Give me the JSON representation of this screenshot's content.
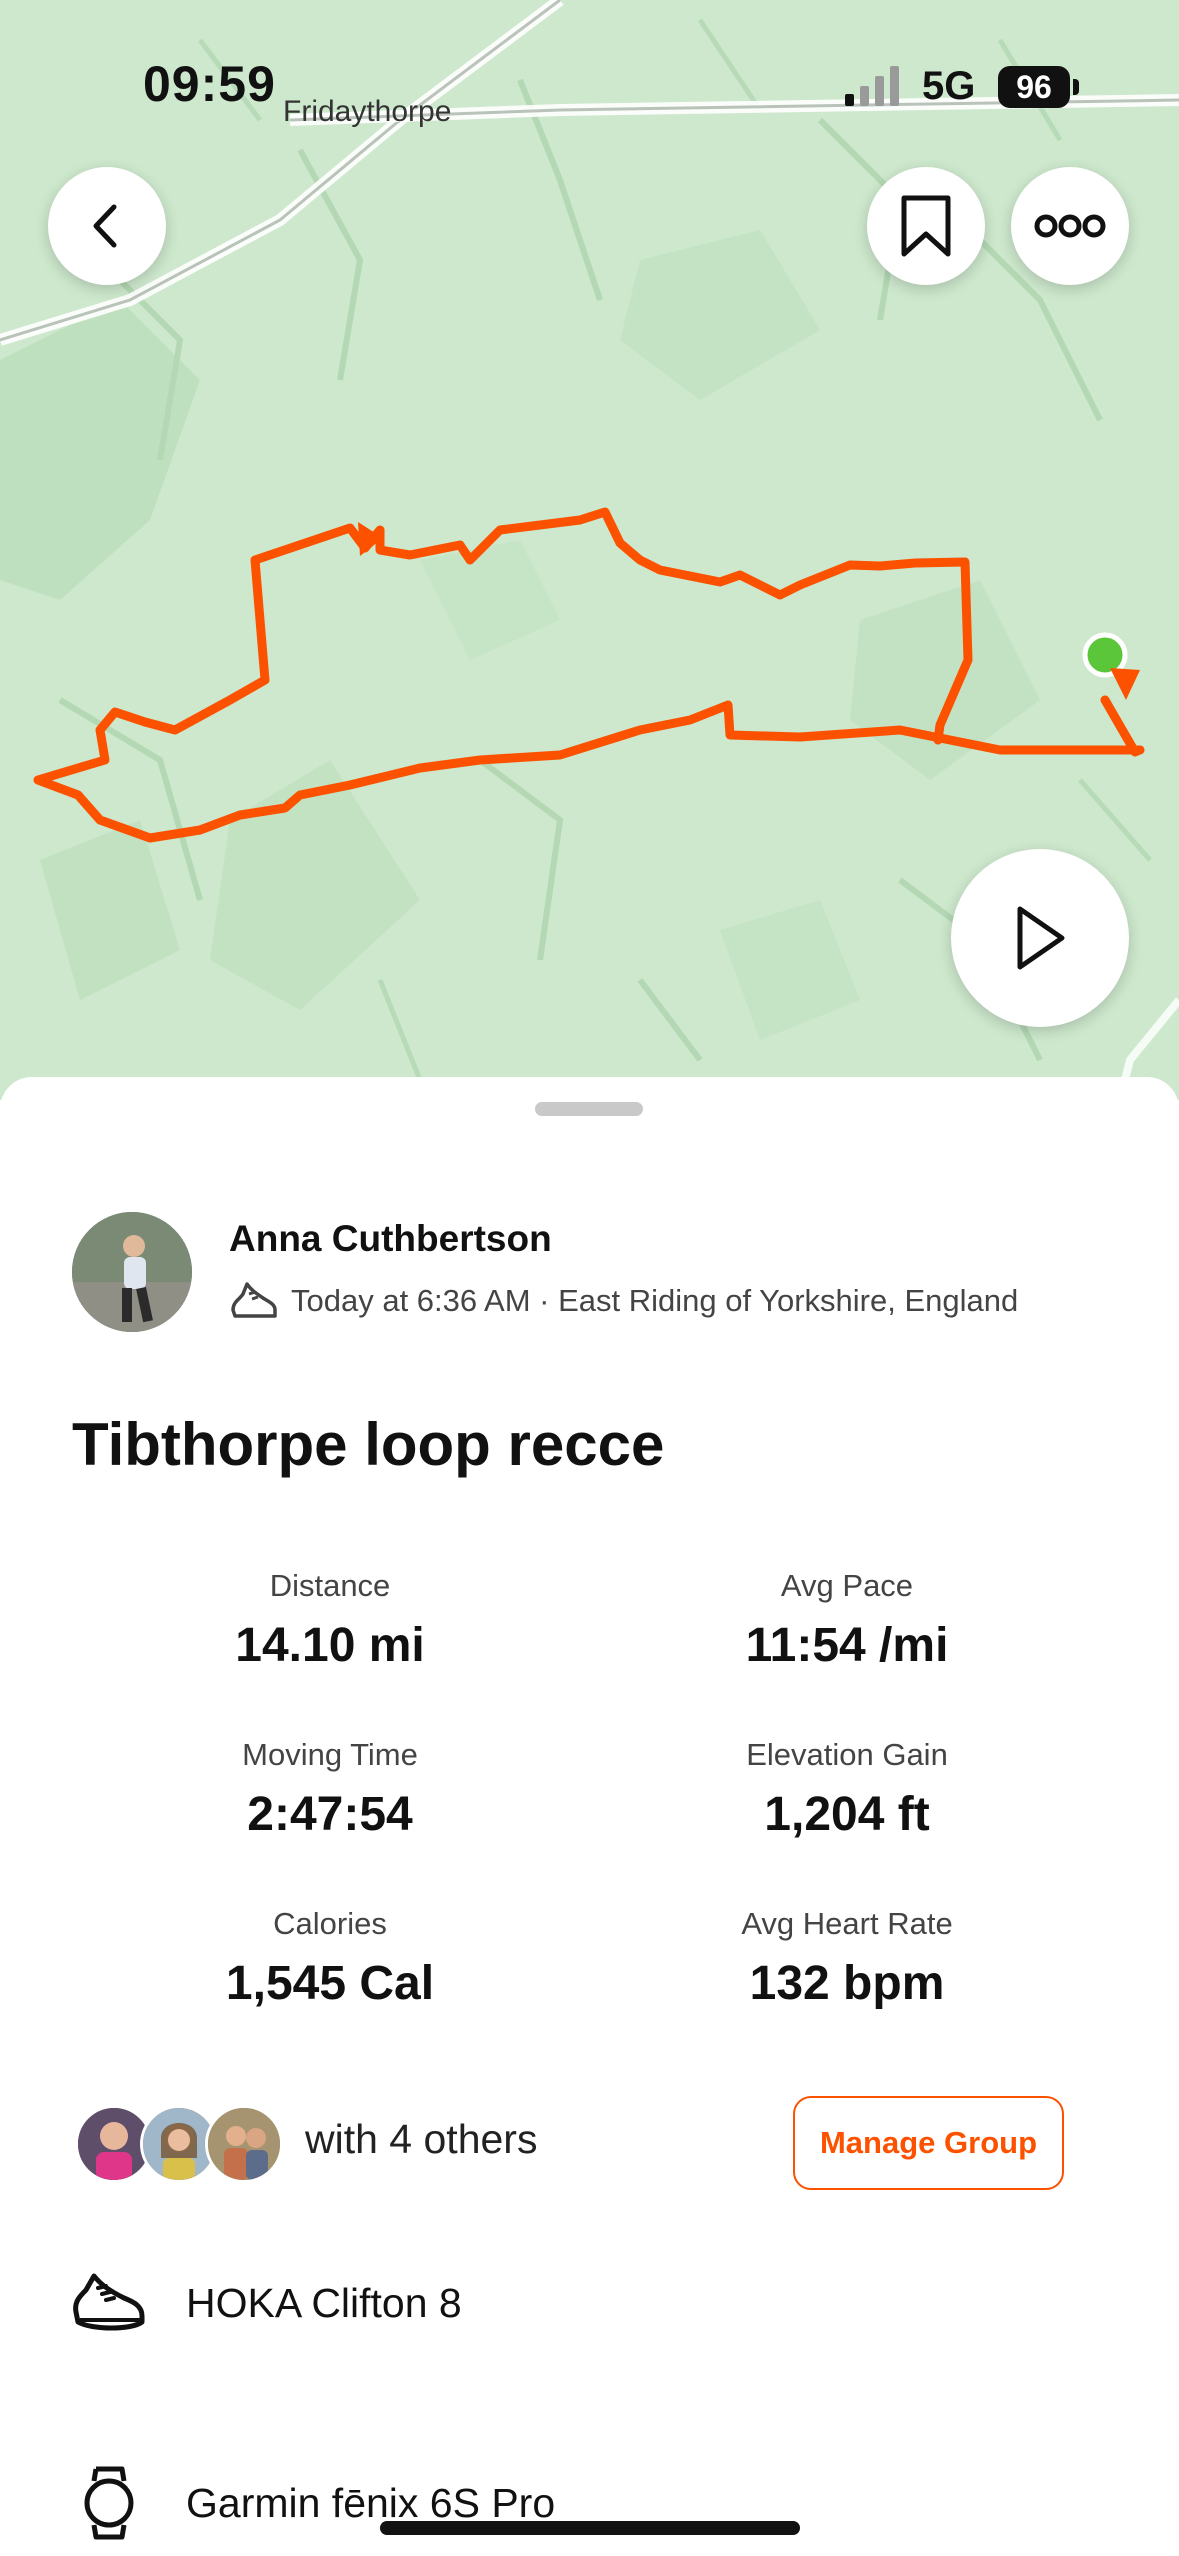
{
  "status_bar": {
    "time": "09:59",
    "network": "5G",
    "battery": "96"
  },
  "map": {
    "place_label": "Fridaythorpe",
    "route_color": "#fc5200",
    "start_color": "#5cc63a"
  },
  "actions": {
    "back": "chevron-left-icon",
    "save": "bookmark-icon",
    "more": "more-icon",
    "play": "play-icon"
  },
  "activity": {
    "athlete_name": "Anna Cuthbertson",
    "meta": "Today at 6:36 AM · East Riding of Yorkshire, England",
    "title": "Tibthorpe loop recce"
  },
  "stats": [
    {
      "label": "Distance",
      "value": "14.10 mi"
    },
    {
      "label": "Avg Pace",
      "value": "11:54 /mi"
    },
    {
      "label": "Moving Time",
      "value": "2:47:54"
    },
    {
      "label": "Elevation Gain",
      "value": "1,204 ft"
    },
    {
      "label": "Calories",
      "value": "1,545 Cal"
    },
    {
      "label": "Avg Heart Rate",
      "value": "132 bpm"
    }
  ],
  "group": {
    "text": "with 4 others",
    "button": "Manage Group"
  },
  "gear": {
    "shoes": "HOKA Clifton 8",
    "device": "Garmin fēnix 6S Pro"
  },
  "colors": {
    "accent": "#fc5200"
  }
}
